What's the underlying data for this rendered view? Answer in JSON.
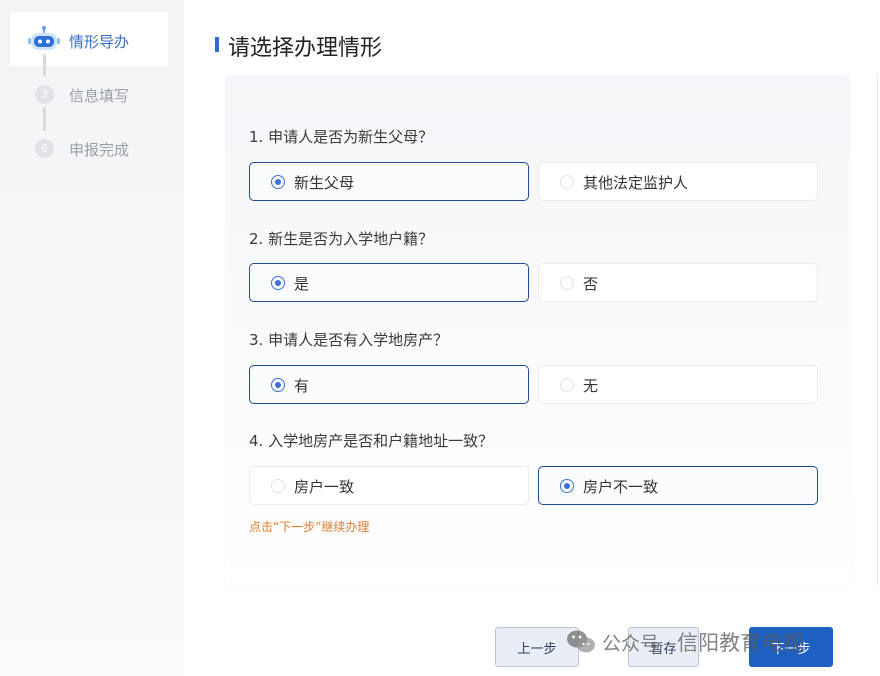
{
  "sidebar": {
    "steps": [
      {
        "label": "情形导办",
        "state": "active",
        "icon": "robot-icon"
      },
      {
        "label": "信息填写",
        "number": "3",
        "state": "pending"
      },
      {
        "label": "申报完成",
        "number": "6",
        "state": "pending"
      }
    ]
  },
  "main": {
    "title": "请选择办理情形",
    "questions": [
      {
        "text": "1. 申请人是否为新生父母？",
        "options": [
          {
            "label": "新生父母",
            "selected": true
          },
          {
            "label": "其他法定监护人",
            "selected": false
          }
        ]
      },
      {
        "text": "2. 新生是否为入学地户籍？",
        "options": [
          {
            "label": "是",
            "selected": true
          },
          {
            "label": "否",
            "selected": false
          }
        ]
      },
      {
        "text": "3. 申请人是否有入学地房产？",
        "options": [
          {
            "label": "有",
            "selected": true
          },
          {
            "label": "无",
            "selected": false
          }
        ]
      },
      {
        "text": "4. 入学地房产是否和户籍地址一致？",
        "options": [
          {
            "label": "房户一致",
            "selected": false
          },
          {
            "label": "房户不一致",
            "selected": true
          }
        ]
      }
    ],
    "hint": "点击“下一步”继续办理"
  },
  "footer": {
    "prev_label": "上一步",
    "save_label": "暂存",
    "next_label": "下一步"
  },
  "watermark": {
    "text1": "公众号 ·",
    "text2": "信阳教育电视"
  },
  "colors": {
    "accent": "#2e6bd6",
    "selected_border": "#1f4b94",
    "hint": "#e07b2c",
    "primary_button": "#1e5fc2"
  }
}
